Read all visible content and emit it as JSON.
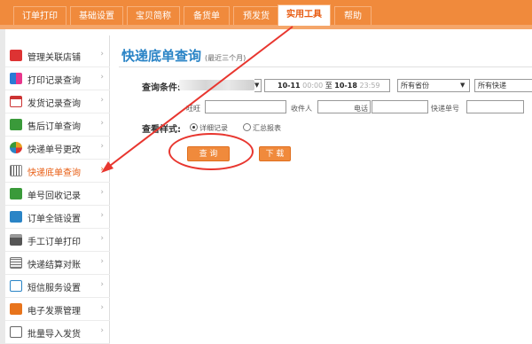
{
  "topnav": {
    "tabs": [
      {
        "label": "订单打印"
      },
      {
        "label": "基础设置"
      },
      {
        "label": "宝贝简称"
      },
      {
        "label": "备货单"
      },
      {
        "label": "预发货"
      },
      {
        "label": "实用工具",
        "active": true
      },
      {
        "label": "帮助"
      }
    ]
  },
  "sidebar": {
    "items": [
      {
        "label": "管理关联店铺",
        "icon": "dice-icon",
        "color": "#d33"
      },
      {
        "label": "打印记录查询",
        "icon": "flickr-dots-icon",
        "color": "#2a7bd6"
      },
      {
        "label": "发货记录查询",
        "icon": "window-icon",
        "color": "#c33"
      },
      {
        "label": "售后订单查询",
        "icon": "bookmark-icon",
        "color": "#3a9a3a"
      },
      {
        "label": "快递单号更改",
        "icon": "pinwheel-icon",
        "color": "#e8a020"
      },
      {
        "label": "快递底单查询",
        "icon": "barcode-icon",
        "color": "#888",
        "active": true
      },
      {
        "label": "单号回收记录",
        "icon": "recycle-icon",
        "color": "#3a9a3a"
      },
      {
        "label": "订单全链设置",
        "icon": "gear-icon",
        "color": "#2a84c6"
      },
      {
        "label": "手工订单打印",
        "icon": "printer-icon",
        "color": "#555"
      },
      {
        "label": "快递结算对账",
        "icon": "ledger-icon",
        "color": "#777"
      },
      {
        "label": "短信服务设置",
        "icon": "sms-icon",
        "color": "#2a84c6"
      },
      {
        "label": "电子发票管理",
        "icon": "invoice-icon",
        "color": "#e8741c"
      },
      {
        "label": "批量导入发货",
        "icon": "import-icon",
        "color": "#666"
      }
    ],
    "arrow": "›"
  },
  "main": {
    "title": "快递底单查询",
    "subtitle": "(最近三个月)",
    "query_label": "查询条件:",
    "date_from": "10-11",
    "time_from": "00:00",
    "to_label": "至",
    "date_to": "10-18",
    "time_to": "23:59",
    "province_select": "所有省份",
    "express_select": "所有快递",
    "wangwang_label": "旺旺",
    "receiver_label": "收件人",
    "phone_label": "电话",
    "tracking_label": "快递单号",
    "style_label": "查看样式:",
    "option_detail": "详细记录",
    "option_summary": "汇总报表",
    "search_button": "查  询",
    "download_button": "下  载"
  }
}
